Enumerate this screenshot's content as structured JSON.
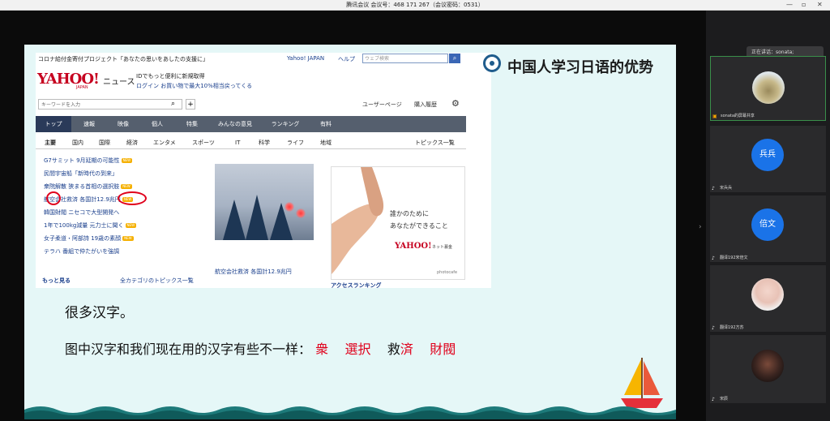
{
  "meeting": {
    "title": "腾讯会议 会议号：468 171 267（会议密码：0531）",
    "controls": [
      "—",
      "▫",
      "✕"
    ],
    "speaking": "正在讲话：sonata;"
  },
  "yahoo": {
    "top_banner": "コロナ給付金寄付プロジェクト「あなたの思いをあしたの支援に」",
    "japan_link": "Yahoo! JAPAN",
    "help_link": "ヘルプ",
    "web_search_placeholder": "ウェブ検索",
    "logo": "YAHOO!",
    "logo_sub": "JAPAN",
    "news_label": "ニュース",
    "promo_line1": "IDでもっと便利に新規取得",
    "promo_line2": "ログイン お買い物で最大10%相当戻ってくる",
    "keyword_placeholder": "キーワードを入力",
    "user_page": "ユーザーページ",
    "purchase_history": "購入履歴",
    "nav_tabs": [
      "トップ",
      "速報",
      "映像",
      "個人",
      "特集",
      "みんなの意見",
      "ランキング",
      "有料"
    ],
    "sub_tabs": [
      "主要",
      "国内",
      "国際",
      "経済",
      "エンタメ",
      "スポーツ",
      "IT",
      "科学",
      "ライフ",
      "地域"
    ],
    "topics_list": "トピックス一覧",
    "headlines": [
      {
        "text": "G7サミット 9月延期の可能性",
        "new": "NEW"
      },
      {
        "text": "民間宇宙船「新時代の到来」",
        "new": ""
      },
      {
        "text": "衆院解散 狭まる首相の選択肢",
        "new": "NEW"
      },
      {
        "text": "航空会社救済 各国計12.9兆円",
        "new": "NEW"
      },
      {
        "text": "韓国財閥 ニセコで大型開発へ",
        "new": ""
      },
      {
        "text": "1年で100kg減量 元力士に聞く",
        "new": "NEW"
      },
      {
        "text": "女子柔道・阿部詩 19歳の素顔",
        "new": "NEW"
      },
      {
        "text": "テラハ 番組で仲たがいを強調",
        "new": ""
      }
    ],
    "more": "もっと見る",
    "all_categories": "全カテゴリのトピックス一覧",
    "photo_caption": "航空会社救済 各国計12.9兆円",
    "ad_line1": "誰かのために",
    "ad_line2": "あなたができること",
    "ad_logo": "YAHOO!",
    "ad_net": "ネット募金",
    "ad_credit": "photocafe",
    "access_ranking": "アクセスランキング"
  },
  "slide": {
    "title": "中国人学习日语的优势",
    "line1": "很多汉字。",
    "line2_prefix": "图中汉字和我们现在用的汉字有些不一样：",
    "examples": [
      "衆",
      "選択",
      "救",
      "済",
      "財閥"
    ]
  },
  "participants": [
    {
      "name": "sonata的屏幕共享",
      "initials": ""
    },
    {
      "name": "宋兵兵",
      "initials": "兵兵"
    },
    {
      "name": "翻译192宋倍文",
      "initials": "倍文"
    },
    {
      "name": "翻译192方苏",
      "initials": ""
    },
    {
      "name": "宋辰",
      "initials": ""
    }
  ],
  "colors": {
    "accent_blue": "#1a73e8",
    "highlight_red": "#e0001b"
  }
}
